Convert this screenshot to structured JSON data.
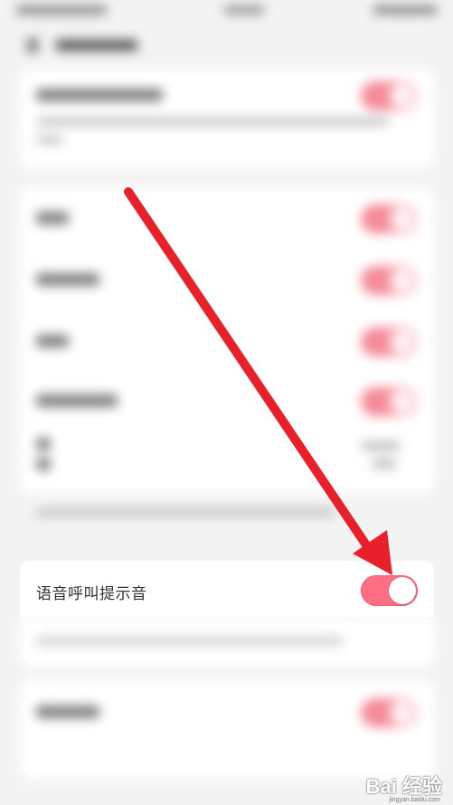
{
  "focus_row": {
    "label": "语音呼叫提示音",
    "toggle_on": true
  },
  "colors": {
    "accent": "#ff6f83",
    "arrow": "#e8202a",
    "background": "#f3f3f3",
    "card": "#ffffff"
  },
  "watermark": {
    "brand": "Bai 经验",
    "url": "jingyan.baidu.com"
  },
  "icons": [
    "back-icon",
    "toggle-icon",
    "red-arrow-annotation"
  ]
}
